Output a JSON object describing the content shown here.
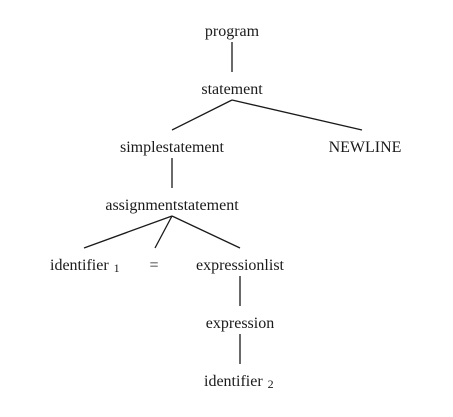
{
  "tree": {
    "nodes": [
      {
        "id": "program",
        "label": "program",
        "sub": ""
      },
      {
        "id": "statement",
        "label": "statement",
        "sub": ""
      },
      {
        "id": "simplestatement",
        "label": "simplestatement",
        "sub": ""
      },
      {
        "id": "newline",
        "label": "NEWLINE",
        "sub": ""
      },
      {
        "id": "assignmentstatement",
        "label": "assignmentstatement",
        "sub": ""
      },
      {
        "id": "identifier1",
        "label": "identifier",
        "sub": "1"
      },
      {
        "id": "equals",
        "label": "=",
        "sub": ""
      },
      {
        "id": "expressionlist",
        "label": "expressionlist",
        "sub": ""
      },
      {
        "id": "expression",
        "label": "expression",
        "sub": ""
      },
      {
        "id": "identifier2",
        "label": "identifier",
        "sub": "2"
      }
    ],
    "edges": [
      {
        "from": "program",
        "to": "statement"
      },
      {
        "from": "statement",
        "to": "simplestatement"
      },
      {
        "from": "statement",
        "to": "newline"
      },
      {
        "from": "simplestatement",
        "to": "assignmentstatement"
      },
      {
        "from": "assignmentstatement",
        "to": "identifier1"
      },
      {
        "from": "assignmentstatement",
        "to": "equals"
      },
      {
        "from": "assignmentstatement",
        "to": "expressionlist"
      },
      {
        "from": "expressionlist",
        "to": "expression"
      },
      {
        "from": "expression",
        "to": "identifier2"
      }
    ]
  }
}
